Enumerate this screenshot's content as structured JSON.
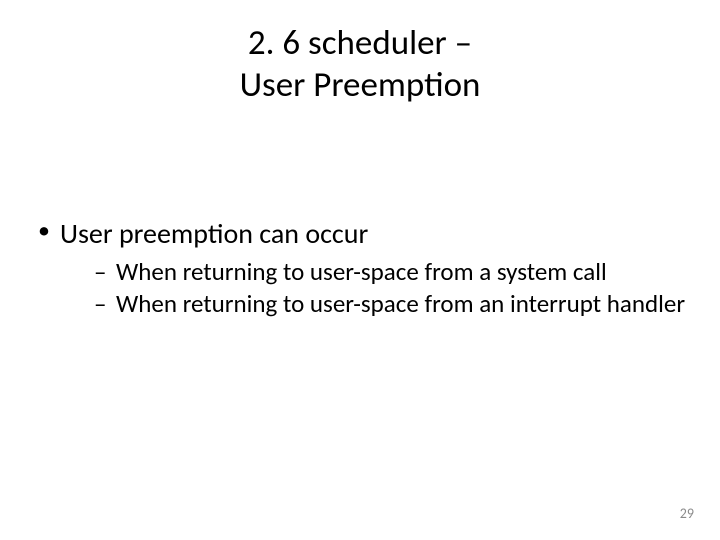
{
  "title": {
    "line1": "2. 6 scheduler –",
    "line2": "User Preemption"
  },
  "bullets": {
    "main": "User preemption can occur",
    "sub1": "When returning to user-space from a system call",
    "sub2": "When returning to user-space from an interrupt handler"
  },
  "page_number": "29"
}
